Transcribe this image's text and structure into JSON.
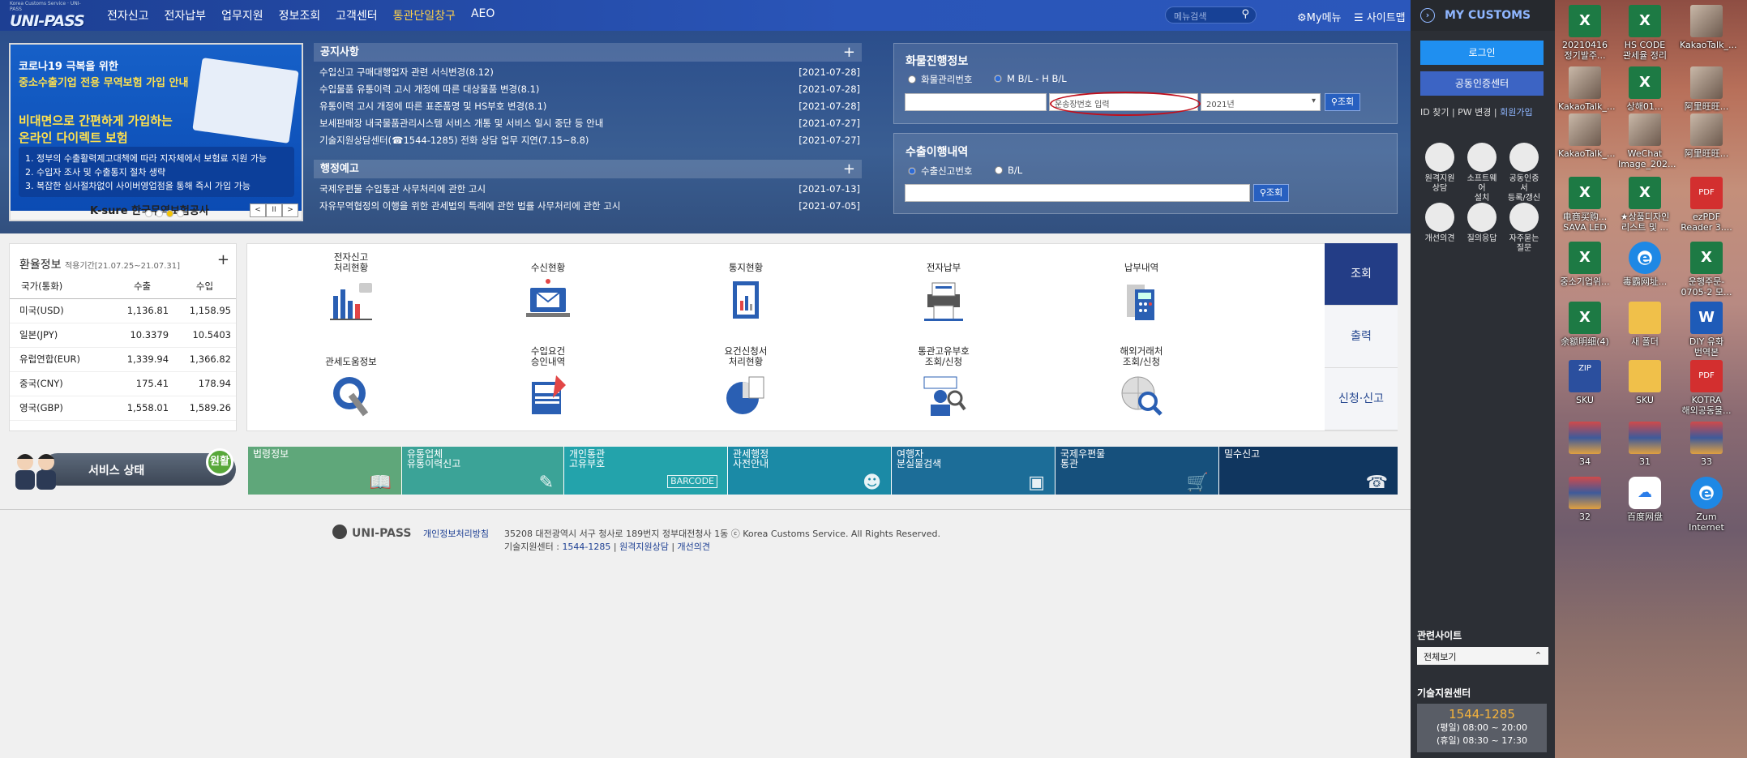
{
  "nav": {
    "logo_small": "Korea Customs Service · UNI-PASS",
    "logo": "UNI-PASS",
    "menu": [
      "전자신고",
      "전자납부",
      "업무지원",
      "정보조회",
      "고객센터",
      "통관단일창구",
      "AEO"
    ],
    "search_placeholder": "메뉴검색",
    "mymenu": "My메뉴",
    "sitemap": "사이트맵"
  },
  "banner": {
    "line1": "코로나19 극복을 위한",
    "line2": "중소수출기업 전용 무역보험 가입 안내",
    "line3": "비대면으로 간편하게 가입하는 온라인 다이렉트 보험",
    "bullets": [
      "1. 정부의 수출활력제고대책에 따라 지자체에서 보험료 지원 가능",
      "2. 수입자 조사 및 수출통지 절차 생략",
      "3. 복잡한 심사절차없이 사이버영업점을 통해 즉시 가입 가능"
    ],
    "ksure": "K-sure 한국무역보험공사",
    "ctl": [
      "<",
      "II",
      ">"
    ]
  },
  "notices": {
    "title": "공지사항",
    "plus": "+",
    "items": [
      {
        "t": "수입신고 구매대행업자 관련 서식변경(8.12)",
        "d": "[2021-07-28]"
      },
      {
        "t": "수입물품 유통이력 고시 개정에 따른 대상물품 변경(8.1)",
        "d": "[2021-07-28]"
      },
      {
        "t": "유통이력 고시 개정에 따른 표준품명 및 HS부호 변경(8.1)",
        "d": "[2021-07-28]"
      },
      {
        "t": "보세판매장 내국물품관리시스템 서비스 개통 및 서비스 일시 중단 등 안내",
        "d": "[2021-07-27]"
      },
      {
        "t": "기술지원상담센터(☎1544-1285) 전화 상담 업무 지연(7.15~8.8)",
        "d": "[2021-07-27]"
      }
    ]
  },
  "admin": {
    "title": "행정예고",
    "plus": "+",
    "items": [
      {
        "t": "국제우편물 수입통관 사무처리에 관한 고시",
        "d": "[2021-07-13]"
      },
      {
        "t": "자유무역협정의 이행을 위한 관세법의 특례에 관한 법률 사무처리에 관한 고시",
        "d": "[2021-07-05]"
      }
    ]
  },
  "cargo": {
    "title": "화물진행정보",
    "radio1": "화물관리번호",
    "radio2": "M B/L - H B/L",
    "placeholder2": "운송장번호 입력",
    "year": "2021년",
    "btn": "조회"
  },
  "export": {
    "title": "수출이행내역",
    "radio1": "수출신고번호",
    "radio2": "B/L",
    "btn": "조회"
  },
  "exchange": {
    "title": "환율정보",
    "period": "적용기간[21.07.25~21.07.31]",
    "plus": "+",
    "headers": [
      "국가(통화)",
      "수출",
      "수입"
    ],
    "rows": [
      [
        "미국(USD)",
        "1,136.81",
        "1,158.95"
      ],
      [
        "일본(JPY)",
        "10.3379",
        "10.5403"
      ],
      [
        "유럽연합(EUR)",
        "1,339.94",
        "1,366.82"
      ],
      [
        "중국(CNY)",
        "175.41",
        "178.94"
      ],
      [
        "영국(GBP)",
        "1,558.01",
        "1,589.26"
      ]
    ]
  },
  "services": [
    "전자신고\n처리현황",
    "수신현황",
    "통지현황",
    "전자납부",
    "납부내역",
    "관세도움정보",
    "수입요건\n승인내역",
    "요건신청서\n처리현황",
    "통관고유부호\n조회/신청",
    "해외거래처\n조회/신청"
  ],
  "tabs": [
    "조회",
    "출력",
    "신청·신고"
  ],
  "status": {
    "label": "서비스 상태",
    "value": "원활"
  },
  "quick": [
    {
      "t": "법령정보",
      "c": "#5fa77a"
    },
    {
      "t": "유통업체\n유통이력신고",
      "c": "#3ba397"
    },
    {
      "t": "개인통관\n고유부호",
      "c": "#23a3ab"
    },
    {
      "t": "관세행정\n사전안내",
      "c": "#1b8aa6"
    },
    {
      "t": "여행자\n분실물검색",
      "c": "#1c6d98"
    },
    {
      "t": "국제우편물\n통관",
      "c": "#16507c"
    },
    {
      "t": "밀수신고",
      "c": "#10365f"
    }
  ],
  "footer": {
    "logo": "UNI-PASS",
    "privacy": "개인정보처리방침",
    "address": "35208 대전광역시 서구 청사로 189번지 정부대전청사 1동 ⓒ Korea Customs Service. All Rights Reserved.",
    "help_label": "기술지원센터 :",
    "help_phone": "1544-1285",
    "remote": "원격지원상담",
    "suggest": "개선의견"
  },
  "mypanel": {
    "title": "MY CUSTOMS",
    "login": "로그인",
    "cert": "공동인증센터",
    "id": "ID 찾기",
    "pw": "PW 변경",
    "join": "회원가입",
    "icons": [
      "원격지원\n상담",
      "소프트웨어\n설치",
      "공동인증서\n등록/갱신",
      "개선의견",
      "질의응답",
      "자주묻는\n질문"
    ],
    "related": "관련사이트",
    "related_sel": "전체보기",
    "tech": "기술지원센터",
    "tech_phone": "1544-1285",
    "tech_h1": "(평일) 08:00 ~ 20:00",
    "tech_h2": "(휴일) 08:30 ~ 17:30"
  },
  "desktop": [
    {
      "l": "20210416\n정기발주...",
      "type": "excel"
    },
    {
      "l": "HS CODE\n관세율 정리",
      "type": "excel"
    },
    {
      "l": "KakaoTalk_...",
      "type": "photo"
    },
    {
      "l": "KakaoTalk_...",
      "type": "photo"
    },
    {
      "l": "상해01...",
      "type": "excel"
    },
    {
      "l": "阿里旺旺...",
      "type": "photo"
    },
    {
      "l": "KakaoTalk_...",
      "type": "photo"
    },
    {
      "l": "WeChat\nImage_202...",
      "type": "photo"
    },
    {
      "l": "阿里旺旺...",
      "type": "photo"
    },
    {
      "l": "电商买购...\nSAVA LED",
      "type": "excel"
    },
    {
      "l": "★상품디자인\n리스트 및 ...",
      "type": "excel"
    },
    {
      "l": "ezPDF\nReader 3....",
      "type": "pdf"
    },
    {
      "l": "중소기업위...",
      "type": "excel"
    },
    {
      "l": "毒霸网址...",
      "type": "ie"
    },
    {
      "l": "운행주문-\n0705-2 모...",
      "type": "excel"
    },
    {
      "l": "余额明细(4)",
      "type": "excel"
    },
    {
      "l": "새 폴더",
      "type": "folder"
    },
    {
      "l": "DIY 유화\n번역본",
      "type": "word"
    },
    {
      "l": "SKU",
      "type": "zip"
    },
    {
      "l": "SKU",
      "type": "folder"
    },
    {
      "l": "KOTRA\n해외공동물...",
      "type": "pdf"
    },
    {
      "l": "34",
      "type": "thumb"
    },
    {
      "l": "31",
      "type": "thumb"
    },
    {
      "l": "33",
      "type": "thumb"
    },
    {
      "l": "32",
      "type": "thumb"
    },
    {
      "l": "百度网盘",
      "type": "baidu"
    },
    {
      "l": "Zum Internet",
      "type": "ie"
    }
  ]
}
